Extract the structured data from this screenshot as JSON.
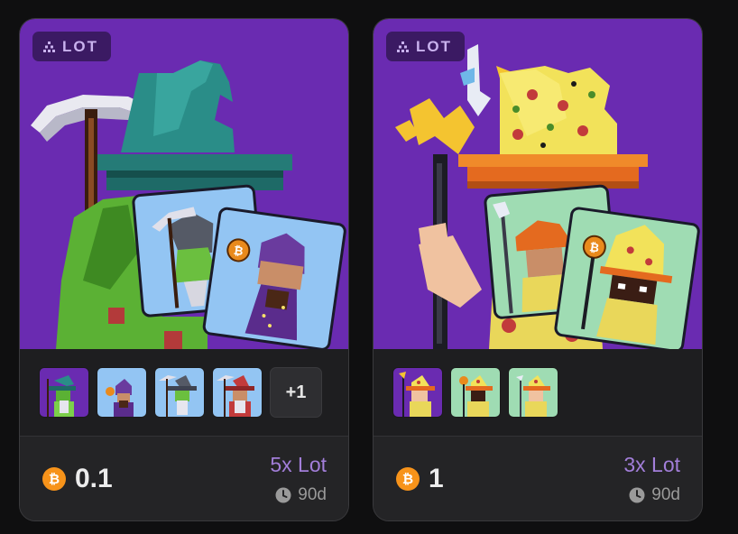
{
  "cards": [
    {
      "badge": "LOT",
      "thumbnails": [
        "reaper-wizard",
        "purple-wizard",
        "reaper-wizard",
        "red-hat-wizard"
      ],
      "more_count": "+1",
      "price": "0.1",
      "lot_size": "5x Lot",
      "duration": "90d"
    },
    {
      "badge": "LOT",
      "thumbnails": [
        "pizza-wizard",
        "pizza-wizard",
        "pizza-wizard"
      ],
      "price": "1",
      "lot_size": "3x Lot",
      "duration": "90d"
    }
  ],
  "colors": {
    "art_background": "#6a2bb1",
    "badge_background": "#3b1a63",
    "lot_text": "#a27ed9",
    "btc_orange": "#f7931a"
  },
  "icons": {
    "badge": "lot-triangle-icon",
    "currency": "bitcoin-icon",
    "duration": "clock-icon"
  }
}
